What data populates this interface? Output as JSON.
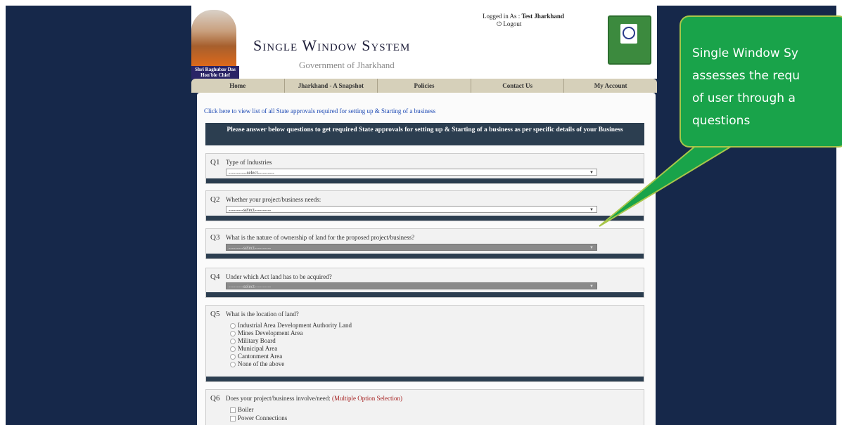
{
  "header": {
    "cm_caption_line1": "Shri Raghubar Das",
    "cm_caption_line2": "Hon'ble Chief Minister",
    "title": "Single Window System",
    "subtitle": "Government of Jharkhand",
    "login_label": "Logged in As : ",
    "login_user": "Test Jharkhand",
    "logout_label": "Logout",
    "logout_icon": "power-icon"
  },
  "nav": [
    "Home",
    "Jharkhand - A Snapshot",
    "Policies",
    "Contact Us",
    "My Account"
  ],
  "approvals_link": "Click here to view list of all State approvals required for setting up & Starting of a business",
  "instruction": "Please answer below questions to get required State approvals for setting up & Starting of a business as per specific details of your Business",
  "questions": [
    {
      "num": "Q1",
      "text": "Type of Industries",
      "select": "-----------select----------"
    },
    {
      "num": "Q2",
      "text": "Whether your project/business needs:",
      "select": "---------select----------"
    },
    {
      "num": "Q3",
      "text": "What is the nature of ownership of land for the proposed project/business?",
      "select": "---------select----------"
    },
    {
      "num": "Q4",
      "text": "Under which Act land has to be acquired?",
      "select": "---------select----------"
    },
    {
      "num": "Q5",
      "text": "What is the location of land?",
      "options": [
        "Industrial Area Development Authority Land",
        "Mines Development Area",
        "Military Board",
        "Municipal Area",
        "Cantonment Area",
        "None of the above"
      ]
    },
    {
      "num": "Q6",
      "text": "Does your project/business involve/need: ",
      "multi_label": "(Multiple Option Selection)",
      "options": [
        "Boiler",
        "Power Connections"
      ]
    }
  ],
  "callout": {
    "line1": "Single Window Sy",
    "line2": "assesses the requ",
    "line3": "of user through a",
    "line4": "questions"
  }
}
